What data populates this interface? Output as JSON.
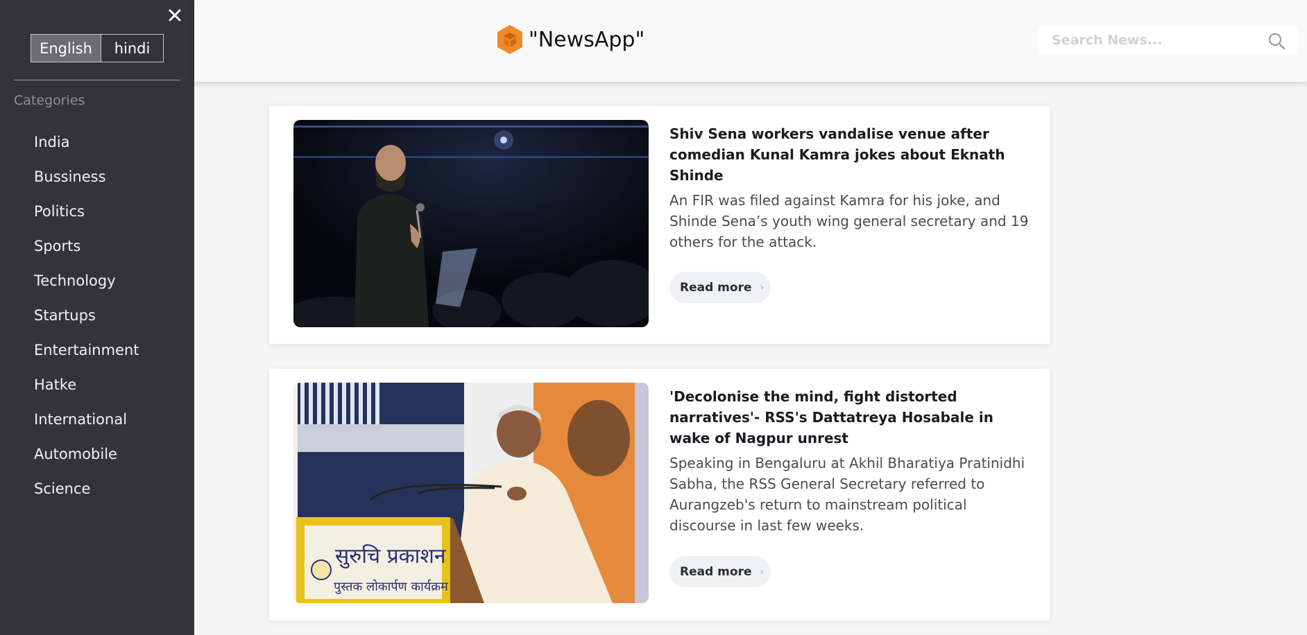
{
  "sidebar": {
    "close_glyph": "✕",
    "languages": [
      {
        "label": "English",
        "active": true
      },
      {
        "label": "hindi",
        "active": false
      }
    ],
    "categories_label": "Categories",
    "items": [
      {
        "label": "India"
      },
      {
        "label": "Bussiness"
      },
      {
        "label": "Politics"
      },
      {
        "label": "Sports"
      },
      {
        "label": "Technology"
      },
      {
        "label": "Startups"
      },
      {
        "label": "Entertainment"
      },
      {
        "label": "Hatke"
      },
      {
        "label": "International"
      },
      {
        "label": "Automobile"
      },
      {
        "label": "Science"
      }
    ]
  },
  "header": {
    "brand_name": "\"NewsApp\"",
    "search": {
      "placeholder": "Search News..."
    }
  },
  "articles": [
    {
      "title": "Shiv Sena workers vandalise venue after comedian Kunal Kamra jokes about Eknath Shinde",
      "description": "An FIR was filed against Kamra for his joke, and Shinde Sena’s youth wing general secretary and 19 others for the attack.",
      "read_more_label": "Read more"
    },
    {
      "title": "'Decolonise the mind, fight distorted narratives'- RSS's Dattatreya Hosabale in wake of Nagpur unrest",
      "description": "Speaking in Bengaluru at Akhil Bharatiya Pratinidhi Sabha, the RSS General Secretary referred to Aurangzeb's return to mainstream political discourse in last few weeks.",
      "read_more_label": "Read more"
    }
  ],
  "colors": {
    "sidebar_bg": "#343438",
    "lang_active_bg": "#6c6c73",
    "brand_icon": "#f08a24",
    "header_bg": "#f9f9fa"
  }
}
